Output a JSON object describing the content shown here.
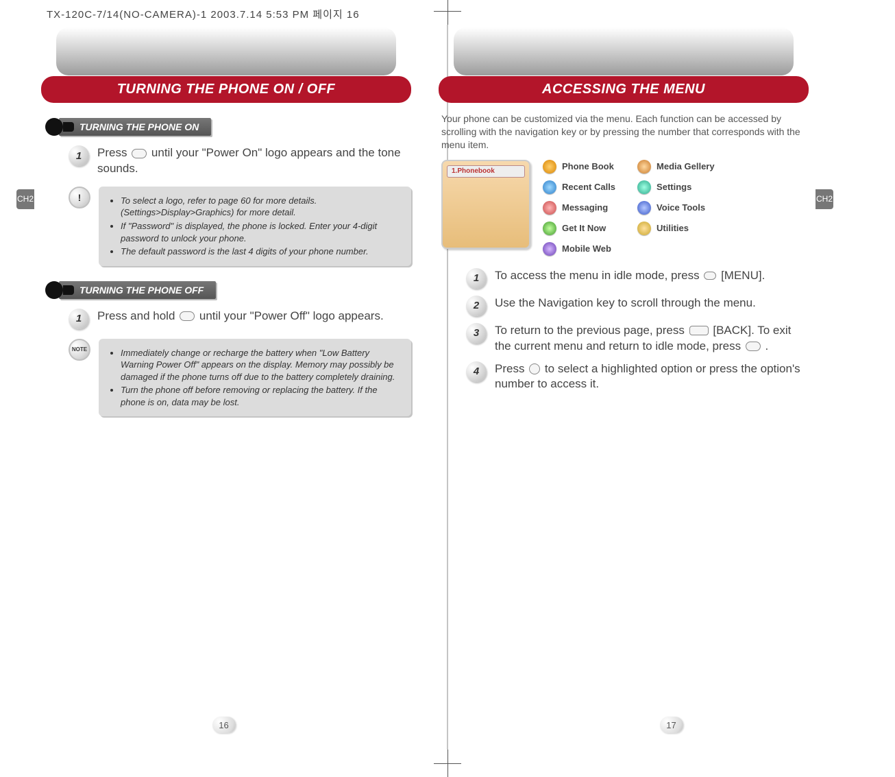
{
  "print_header": "TX-120C-7/14(NO-CAMERA)-1  2003.7.14 5:53 PM 페이지 16",
  "side_tabs": {
    "left": "CH2",
    "right": "CH2"
  },
  "left_page": {
    "title": "TURNING THE PHONE ON / OFF",
    "section_on": {
      "heading": "TURNING THE PHONE ON",
      "step1_pre": "Press ",
      "step1_post": " until your \"Power On\" logo appears and the tone sounds.",
      "tips": [
        "To select a logo, refer to page 60 for more details. (Settings>Display>Graphics) for more detail.",
        "If \"Password\" is displayed, the phone is locked. Enter your 4-digit password to unlock your phone.",
        "The default password is the last 4 digits of your phone number."
      ]
    },
    "section_off": {
      "heading": "TURNING THE PHONE OFF",
      "step1_pre": "Press and hold ",
      "step1_post": " until your \"Power Off\" logo appears.",
      "notes": [
        "Immediately change or recharge the battery when \"Low Battery Warning Power Off\" appears on the display. Memory may possibly be damaged if the phone turns off due to the battery completely draining.",
        "Turn the phone off before removing or replacing the battery. If the phone is on, data may be lost."
      ]
    },
    "page_number": "16"
  },
  "right_page": {
    "title": "ACCESSING THE MENU",
    "intro": "Your phone can be customized via the menu. Each function can be accessed by scrolling with the navigation key or by pressing the number that corresponds with the menu item.",
    "thumb_label": "1.Phonebook",
    "menu_col1": [
      "Phone Book",
      "Recent Calls",
      "Messaging",
      "Get It Now",
      "Mobile Web"
    ],
    "menu_col2": [
      "Media Gellery",
      "Settings",
      "Voice Tools",
      "Utilities"
    ],
    "steps": {
      "s1_pre": "To access the menu in idle mode, press ",
      "s1_post": " [MENU].",
      "s2": "Use the Navigation key to scroll through the menu.",
      "s3_a": "To return to the previous page, press ",
      "s3_b": " [BACK]. To exit the current menu and return to idle mode, press ",
      "s3_c": " .",
      "s4_a": "Press ",
      "s4_b": " to select a highlighted option or press the option's number to access it."
    },
    "page_number": "17"
  }
}
